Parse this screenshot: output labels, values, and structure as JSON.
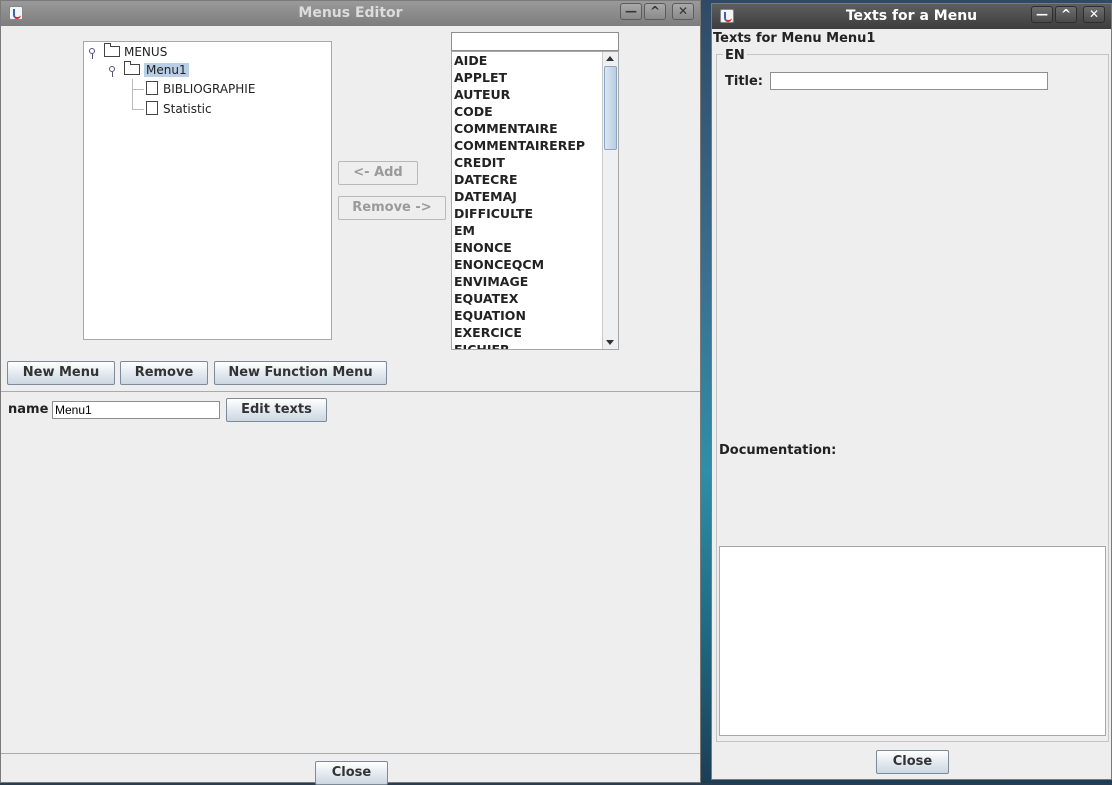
{
  "menus_editor": {
    "title": "Menus Editor",
    "tree": {
      "root": "MENUS",
      "selected": "Menu1",
      "children": [
        "BIBLIOGRAPHIE",
        "Statistic"
      ]
    },
    "add_button": "<- Add",
    "remove_right_button": "Remove ->",
    "functions_list": [
      "AIDE",
      "APPLET",
      "AUTEUR",
      "CODE",
      "COMMENTAIRE",
      "COMMENTAIREREP",
      "CREDIT",
      "DATECRE",
      "DATEMAJ",
      "DIFFICULTE",
      "EM",
      "ENONCE",
      "ENONCEQCM",
      "ENVIMAGE",
      "EQUATEX",
      "EQUATION",
      "EXERCICE",
      "FICHIER"
    ],
    "search_value": "",
    "new_menu_button": "New Menu",
    "remove_button": "Remove",
    "new_function_menu_button": "New Function Menu",
    "name_label": "name",
    "name_value": "Menu1",
    "edit_texts_button": "Edit texts",
    "close_button": "Close"
  },
  "texts_window": {
    "title": "Texts for a Menu",
    "heading": "Texts for Menu Menu1",
    "language": "EN",
    "title_label": "Title:",
    "title_value": "",
    "documentation_label": "Documentation:",
    "documentation_value": "",
    "close_button": "Close"
  },
  "window_controls": {
    "minimize": "—",
    "maximize": "^",
    "close": "✕"
  }
}
